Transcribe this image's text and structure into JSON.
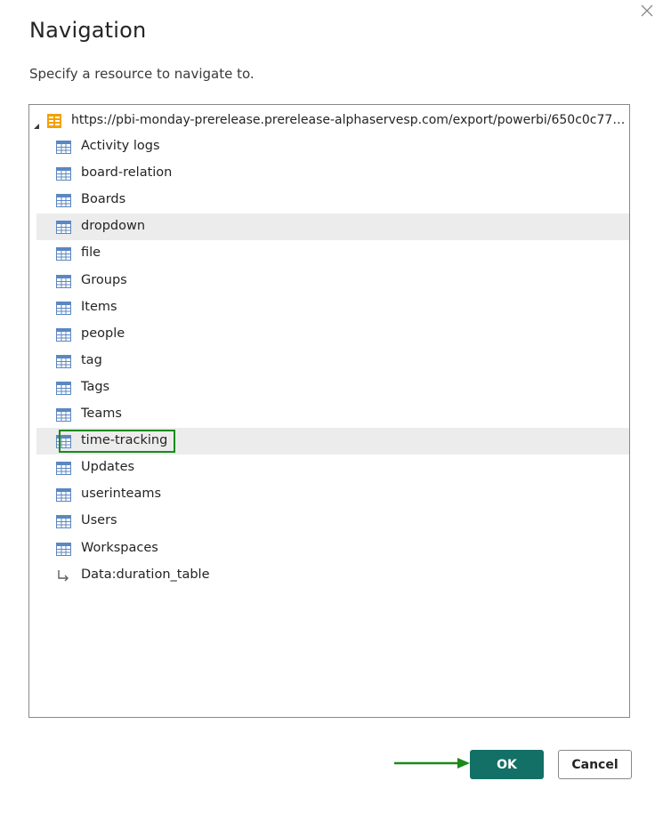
{
  "dialog": {
    "title": "Navigation",
    "subtitle": "Specify a resource to navigate to."
  },
  "tree": {
    "root": {
      "label": "https://pbi-monday-prerelease.prerelease-alphaservesp.com/export/powerbi/650c0c7757dfa...",
      "icon": "database-icon",
      "expanded": true
    },
    "items": [
      {
        "label": "Activity logs",
        "icon": "table-icon"
      },
      {
        "label": "board-relation",
        "icon": "table-icon"
      },
      {
        "label": "Boards",
        "icon": "table-icon"
      },
      {
        "label": "dropdown",
        "icon": "table-icon",
        "hovered": true
      },
      {
        "label": "file",
        "icon": "table-icon"
      },
      {
        "label": "Groups",
        "icon": "table-icon"
      },
      {
        "label": "Items",
        "icon": "table-icon"
      },
      {
        "label": "people",
        "icon": "table-icon"
      },
      {
        "label": "tag",
        "icon": "table-icon"
      },
      {
        "label": "Tags",
        "icon": "table-icon"
      },
      {
        "label": "Teams",
        "icon": "table-icon"
      },
      {
        "label": "time-tracking",
        "icon": "table-icon",
        "selected": true,
        "highlight_color": "#1a8a1a"
      },
      {
        "label": "Updates",
        "icon": "table-icon"
      },
      {
        "label": "userinteams",
        "icon": "table-icon"
      },
      {
        "label": "Users",
        "icon": "table-icon"
      },
      {
        "label": "Workspaces",
        "icon": "table-icon"
      },
      {
        "label": "Data:duration_table",
        "icon": "function-arrow-icon"
      }
    ]
  },
  "buttons": {
    "ok": "OK",
    "cancel": "Cancel"
  },
  "colors": {
    "accent": "#137066",
    "annotation": "#1a8a1a",
    "icon_blue": "#5b87c2",
    "root_icon": "#f2a100"
  }
}
